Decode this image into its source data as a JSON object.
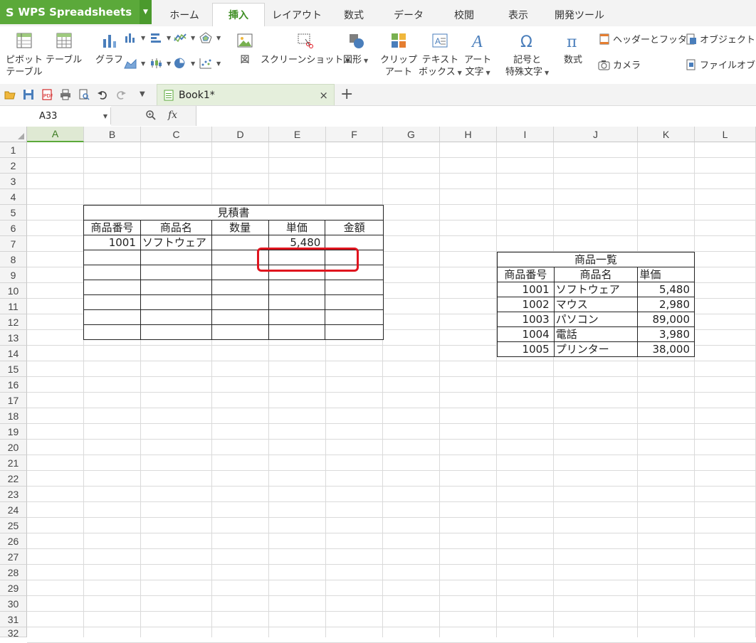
{
  "app": {
    "title": "WPS Spreadsheets",
    "logo_glyph": "S",
    "brand_color": "#5ba93a"
  },
  "menu_tabs": [
    "ホーム",
    "挿入",
    "レイアウト",
    "数式",
    "データ",
    "校閲",
    "表示",
    "開発ツール"
  ],
  "active_tab": "挿入",
  "ribbon": {
    "pivot": [
      "ピボット",
      "テーブル"
    ],
    "table": "テーブル",
    "graph": "グラフ",
    "picture": "図",
    "screenshot": "スクリーンショット",
    "shapes": "図形",
    "clipart": [
      "クリップ",
      "アート"
    ],
    "textbox": [
      "テキスト",
      "ボックス"
    ],
    "art_text": [
      "アート",
      "文字"
    ],
    "symbols": [
      "記号と",
      "特殊文字"
    ],
    "formula": "数式",
    "header_footer": "ヘッダーとフッター",
    "object": "オブジェクト",
    "camera": "カメラ",
    "file_object": "ファイルオブジ"
  },
  "document": {
    "tab_name": "Book1*",
    "close_glyph": "×",
    "new_tab_glyph": "+"
  },
  "formula_bar": {
    "name_box": "A33",
    "zoom_glyph": "🔍",
    "fx_label": "fx",
    "content": ""
  },
  "columns": [
    "A",
    "B",
    "C",
    "D",
    "E",
    "F",
    "G",
    "H",
    "I",
    "J",
    "K",
    "L"
  ],
  "active_column": "A",
  "rows": [
    "1",
    "2",
    "3",
    "4",
    "5",
    "6",
    "7",
    "8",
    "9",
    "10",
    "11",
    "12",
    "13",
    "14",
    "15",
    "16",
    "17",
    "18",
    "19",
    "20",
    "21",
    "22",
    "23",
    "24",
    "25",
    "26",
    "27",
    "28",
    "29",
    "30",
    "31",
    "32"
  ],
  "estimate": {
    "title": "見積書",
    "headers": [
      "商品番号",
      "商品名",
      "数量",
      "単価",
      "金額"
    ],
    "rows": [
      [
        "1001",
        "ソフトウェア",
        "",
        "5,480",
        ""
      ],
      [
        "",
        "",
        "",
        "",
        ""
      ],
      [
        "",
        "",
        "",
        "",
        ""
      ],
      [
        "",
        "",
        "",
        "",
        ""
      ],
      [
        "",
        "",
        "",
        "",
        ""
      ],
      [
        "",
        "",
        "",
        "",
        ""
      ],
      [
        "",
        "",
        "",
        "",
        ""
      ]
    ]
  },
  "product_list": {
    "title": "商品一覧",
    "headers": [
      "商品番号",
      "商品名",
      "単価"
    ],
    "rows": [
      [
        "1001",
        "ソフトウェア",
        "5,480"
      ],
      [
        "1002",
        "マウス",
        "2,980"
      ],
      [
        "1003",
        "パソコン",
        "89,000"
      ],
      [
        "1004",
        "電話",
        "3,980"
      ],
      [
        "1005",
        "プリンター",
        "38,000"
      ]
    ]
  },
  "highlight_color": "#e0141e"
}
